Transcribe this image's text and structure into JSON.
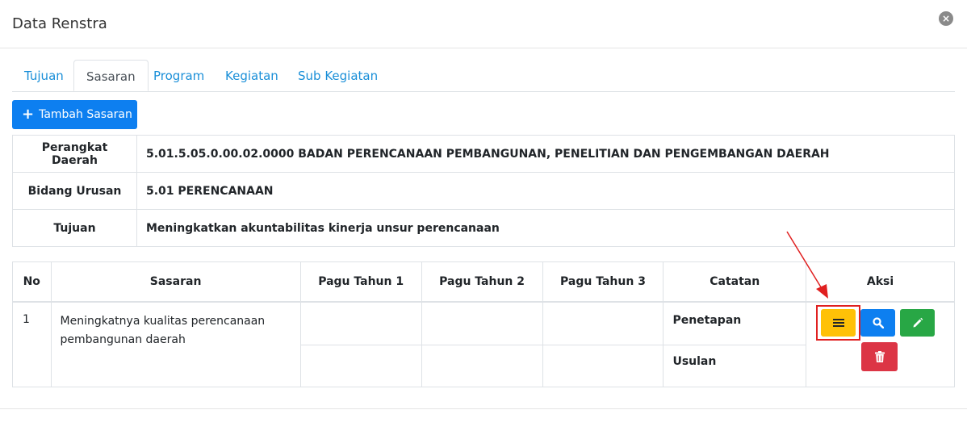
{
  "modal": {
    "title": "Data Renstra",
    "close_symbol": "×"
  },
  "tabs": [
    {
      "label": "Tujuan",
      "active": false
    },
    {
      "label": "Sasaran",
      "active": true
    },
    {
      "label": "Program",
      "active": false
    },
    {
      "label": "Kegiatan",
      "active": false
    },
    {
      "label": "Sub Kegiatan",
      "active": false
    }
  ],
  "add_button": {
    "label": "Tambah Sasaran",
    "color": "#0d7ff0"
  },
  "info": [
    {
      "label": "Perangkat Daerah",
      "value": "5.01.5.05.0.00.02.0000 BADAN PERENCANAAN PEMBANGUNAN, PENELITIAN DAN PENGEMBANGAN DAERAH"
    },
    {
      "label": "Bidang Urusan",
      "value": "5.01 PERENCANAAN"
    },
    {
      "label": "Tujuan",
      "value": "Meningkatkan akuntabilitas kinerja unsur perencanaan"
    }
  ],
  "table": {
    "headers": [
      "No",
      "Sasaran",
      "Pagu Tahun 1",
      "Pagu Tahun 2",
      "Pagu Tahun 3",
      "Catatan",
      "Aksi"
    ],
    "rows": [
      {
        "no": "1",
        "sasaran": "Meningkatnya kualitas perencanaan pembangunan daerah",
        "catatan": [
          "Penetapan",
          "Usulan"
        ]
      }
    ]
  },
  "actions": [
    {
      "name": "menu-icon",
      "color": "#ffc107"
    },
    {
      "name": "search-icon",
      "color": "#0d7ff0"
    },
    {
      "name": "pencil-icon",
      "color": "#28a745"
    },
    {
      "name": "trash-icon",
      "color": "#dc3545"
    }
  ],
  "annotation": {
    "color": "#e02020"
  }
}
